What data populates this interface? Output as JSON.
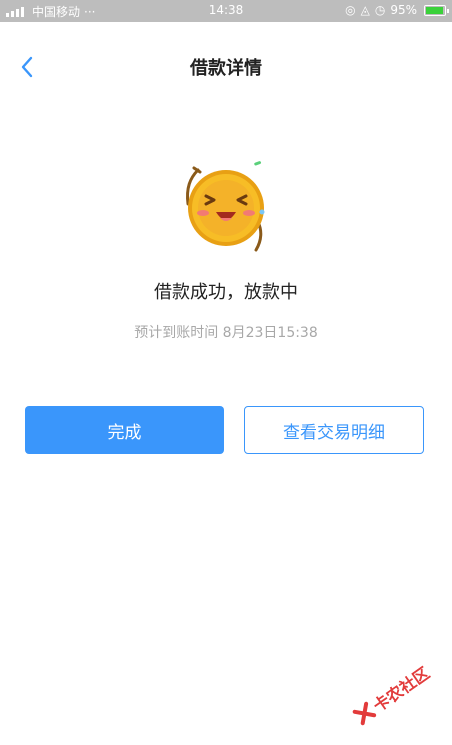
{
  "status_bar": {
    "carrier": "中国移动",
    "dots": "···",
    "time": "14:38",
    "battery_percent": "95%",
    "battery_level": 0.95
  },
  "nav": {
    "title": "借款详情",
    "back_icon": "chevron-left-icon"
  },
  "result": {
    "icon": "smiling-coin-mascot",
    "title": "借款成功，放款中",
    "eta": "预计到账时间 8月23日15:38"
  },
  "actions": {
    "done_label": "完成",
    "detail_label": "查看交易明细"
  },
  "watermark": {
    "text": "卡农社区"
  },
  "colors": {
    "accent": "#3a96fb",
    "status_bar": "#bdbdbd",
    "title_text": "#222222",
    "muted_text": "#a8a8a8",
    "coin": "#f5b81c",
    "watermark": "#e23b3b"
  }
}
